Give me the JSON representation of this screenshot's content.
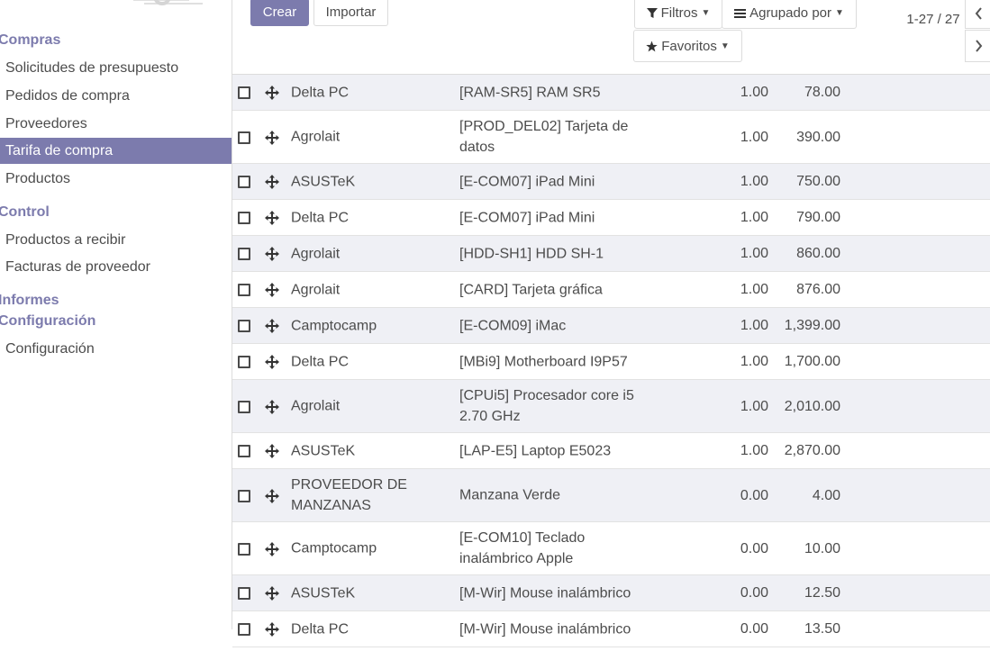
{
  "sidebar": {
    "sections": [
      {
        "title": "Compras",
        "items": [
          {
            "label": "Solicitudes de presupuesto",
            "active": false
          },
          {
            "label": "Pedidos de compra",
            "active": false
          },
          {
            "label": "Proveedores",
            "active": false
          },
          {
            "label": "Tarifa de compra",
            "active": true
          },
          {
            "label": "Productos",
            "active": false
          }
        ]
      },
      {
        "title": "Control",
        "items": [
          {
            "label": "Productos a recibir",
            "active": false
          },
          {
            "label": "Facturas de proveedor",
            "active": false
          }
        ]
      },
      {
        "title": "Informes",
        "items": []
      },
      {
        "title": "Configuración",
        "items": [
          {
            "label": "Configuración",
            "active": false
          }
        ]
      }
    ]
  },
  "toolbar": {
    "create_label": "Crear",
    "import_label": "Importar",
    "filters_label": "Filtros",
    "groupby_label": "Agrupado por",
    "favorites_label": "Favoritos"
  },
  "pager": {
    "value": "1-27 / 27"
  },
  "rows": [
    {
      "supplier": "Delta PC",
      "product": "[RAM-SR5] RAM SR5",
      "qty": "1.00",
      "price": "78.00"
    },
    {
      "supplier": "Agrolait",
      "product": "[PROD_DEL02] Tarjeta de datos",
      "qty": "1.00",
      "price": "390.00"
    },
    {
      "supplier": "ASUSTeK",
      "product": "[E-COM07] iPad Mini",
      "qty": "1.00",
      "price": "750.00"
    },
    {
      "supplier": "Delta PC",
      "product": "[E-COM07] iPad Mini",
      "qty": "1.00",
      "price": "790.00"
    },
    {
      "supplier": "Agrolait",
      "product": "[HDD-SH1] HDD SH-1",
      "qty": "1.00",
      "price": "860.00"
    },
    {
      "supplier": "Agrolait",
      "product": "[CARD] Tarjeta gráfica",
      "qty": "1.00",
      "price": "876.00"
    },
    {
      "supplier": "Camptocamp",
      "product": "[E-COM09] iMac",
      "qty": "1.00",
      "price": "1,399.00"
    },
    {
      "supplier": "Delta PC",
      "product": "[MBi9] Motherboard I9P57",
      "qty": "1.00",
      "price": "1,700.00"
    },
    {
      "supplier": "Agrolait",
      "product": "[CPUi5] Procesador core i5 2.70 GHz",
      "qty": "1.00",
      "price": "2,010.00"
    },
    {
      "supplier": "ASUSTeK",
      "product": "[LAP-E5] Laptop E5023",
      "qty": "1.00",
      "price": "2,870.00"
    },
    {
      "supplier": "PROVEEDOR DE MANZANAS",
      "product": "Manzana Verde",
      "qty": "0.00",
      "price": "4.00"
    },
    {
      "supplier": "Camptocamp",
      "product": "[E-COM10] Teclado inalámbrico Apple",
      "qty": "0.00",
      "price": "10.00"
    },
    {
      "supplier": "ASUSTeK",
      "product": "[M-Wir] Mouse inalámbrico",
      "qty": "0.00",
      "price": "12.50"
    },
    {
      "supplier": "Delta PC",
      "product": "[M-Wir] Mouse inalámbrico",
      "qty": "0.00",
      "price": "13.50"
    }
  ],
  "colors": {
    "accent": "#7c7bad",
    "row_stripe": "#eff0f5",
    "border": "#dcdcdc"
  },
  "icons": {
    "row_handle": "arrows-move-icon",
    "filter": "funnel-icon",
    "groupby": "list-icon",
    "favorites": "star-icon"
  }
}
